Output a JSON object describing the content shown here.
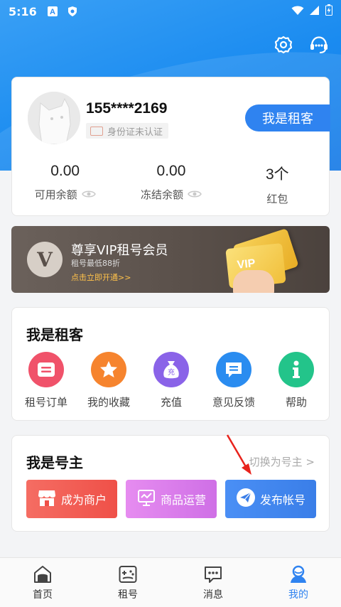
{
  "status_bar": {
    "time": "5:16"
  },
  "profile": {
    "phone": "155****2169",
    "id_status": "身份证未认证",
    "role_button": "我是租客",
    "stats": [
      {
        "value": "0.00",
        "label": "可用余额"
      },
      {
        "value": "0.00",
        "label": "冻结余额"
      },
      {
        "value": "3个",
        "label": "红包"
      }
    ]
  },
  "vip": {
    "logo_letter": "V",
    "title": "尊享VIP租号会员",
    "subtitle": "租号最低88折",
    "link": "点击立即开通>>",
    "card_text": "VIP"
  },
  "tenant": {
    "title": "我是租客",
    "items": [
      {
        "label": "租号订单",
        "icon": "order-icon",
        "color": "#f0526a"
      },
      {
        "label": "我的收藏",
        "icon": "star-icon",
        "color": "#f6842e"
      },
      {
        "label": "充值",
        "icon": "money-bag-icon",
        "color": "#8a63e8",
        "badge": "充"
      },
      {
        "label": "意见反馈",
        "icon": "feedback-icon",
        "color": "#2a8cf0"
      },
      {
        "label": "帮助",
        "icon": "info-icon",
        "color": "#23c48a"
      }
    ]
  },
  "owner": {
    "title": "我是号主",
    "switch_link": "切换为号主 >",
    "buttons": [
      {
        "label": "成为商户",
        "icon": "shop-icon"
      },
      {
        "label": "商品运营",
        "icon": "chart-board-icon"
      },
      {
        "label": "发布帐号",
        "icon": "send-plane-icon"
      }
    ]
  },
  "nav": [
    {
      "label": "首页",
      "icon": "home-icon"
    },
    {
      "label": "租号",
      "icon": "gamepad-icon"
    },
    {
      "label": "消息",
      "icon": "message-icon"
    },
    {
      "label": "我的",
      "icon": "profile-icon",
      "active": true
    }
  ]
}
